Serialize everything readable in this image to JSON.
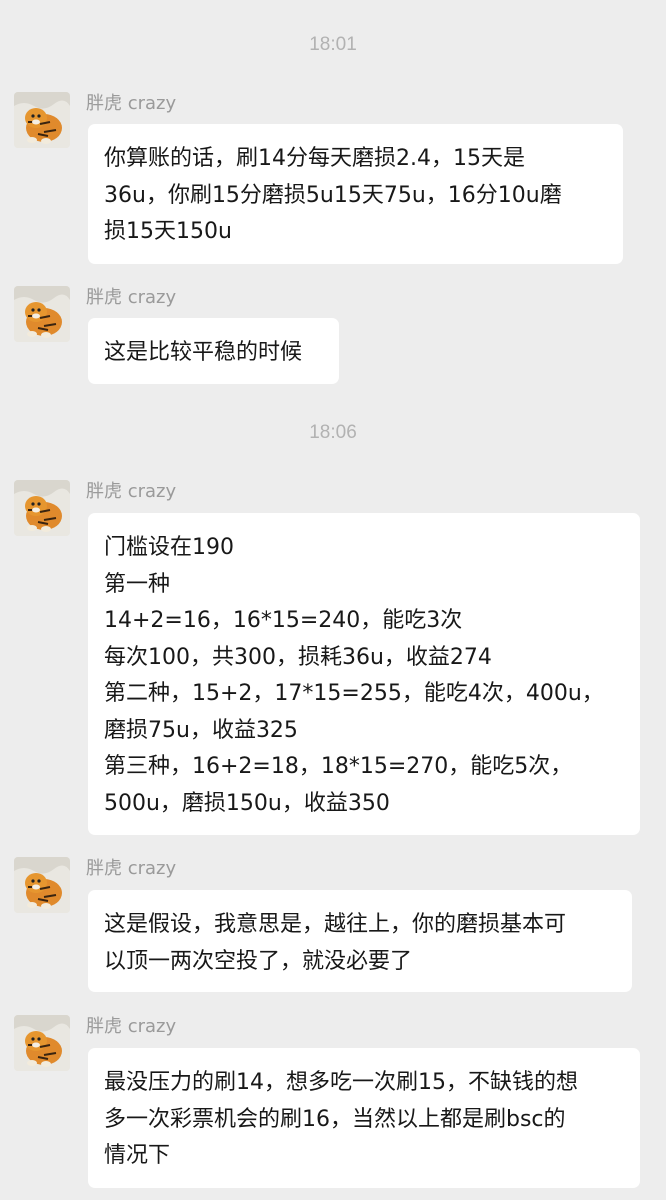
{
  "timestamps": [
    "18:01",
    "18:06"
  ],
  "sender_name": "胖虎 crazy",
  "messages": [
    {
      "sender": "胖虎 crazy",
      "lines": [
        "你算账的话，刷14分每天磨损2.4，15天是",
        "36u，你刷15分磨损5u15天75u，16分10u磨",
        "损15天150u"
      ]
    },
    {
      "sender": "胖虎 crazy",
      "lines": [
        "这是比较平稳的时候"
      ]
    },
    {
      "sender": "胖虎 crazy",
      "lines": [
        "门槛设在190",
        "第一种",
        "14+2=16，16*15=240，能吃3次",
        "每次100，共300，损耗36u，收益274",
        "第二种，15+2，17*15=255，能吃4次，400u，",
        "磨损75u，收益325",
        "第三种，16+2=18，18*15=270，能吃5次，",
        "500u，磨损150u，收益350"
      ]
    },
    {
      "sender": "胖虎 crazy",
      "lines": [
        "这是假设，我意思是，越往上，你的磨损基本可",
        "以顶一两次空投了，就没必要了"
      ]
    },
    {
      "sender": "胖虎 crazy",
      "lines": [
        "最没压力的刷14，想多吃一次刷15，不缺钱的想",
        "多一次彩票机会的刷16，当然以上都是刷bsc的",
        "情况下"
      ]
    }
  ],
  "colors": {
    "background": "#ededed",
    "bubble": "#ffffff",
    "text": "#181818",
    "sender": "#9a9a9a",
    "timestamp": "#b2b2b2"
  },
  "icons": {
    "avatar": "tiger-avatar-icon"
  }
}
